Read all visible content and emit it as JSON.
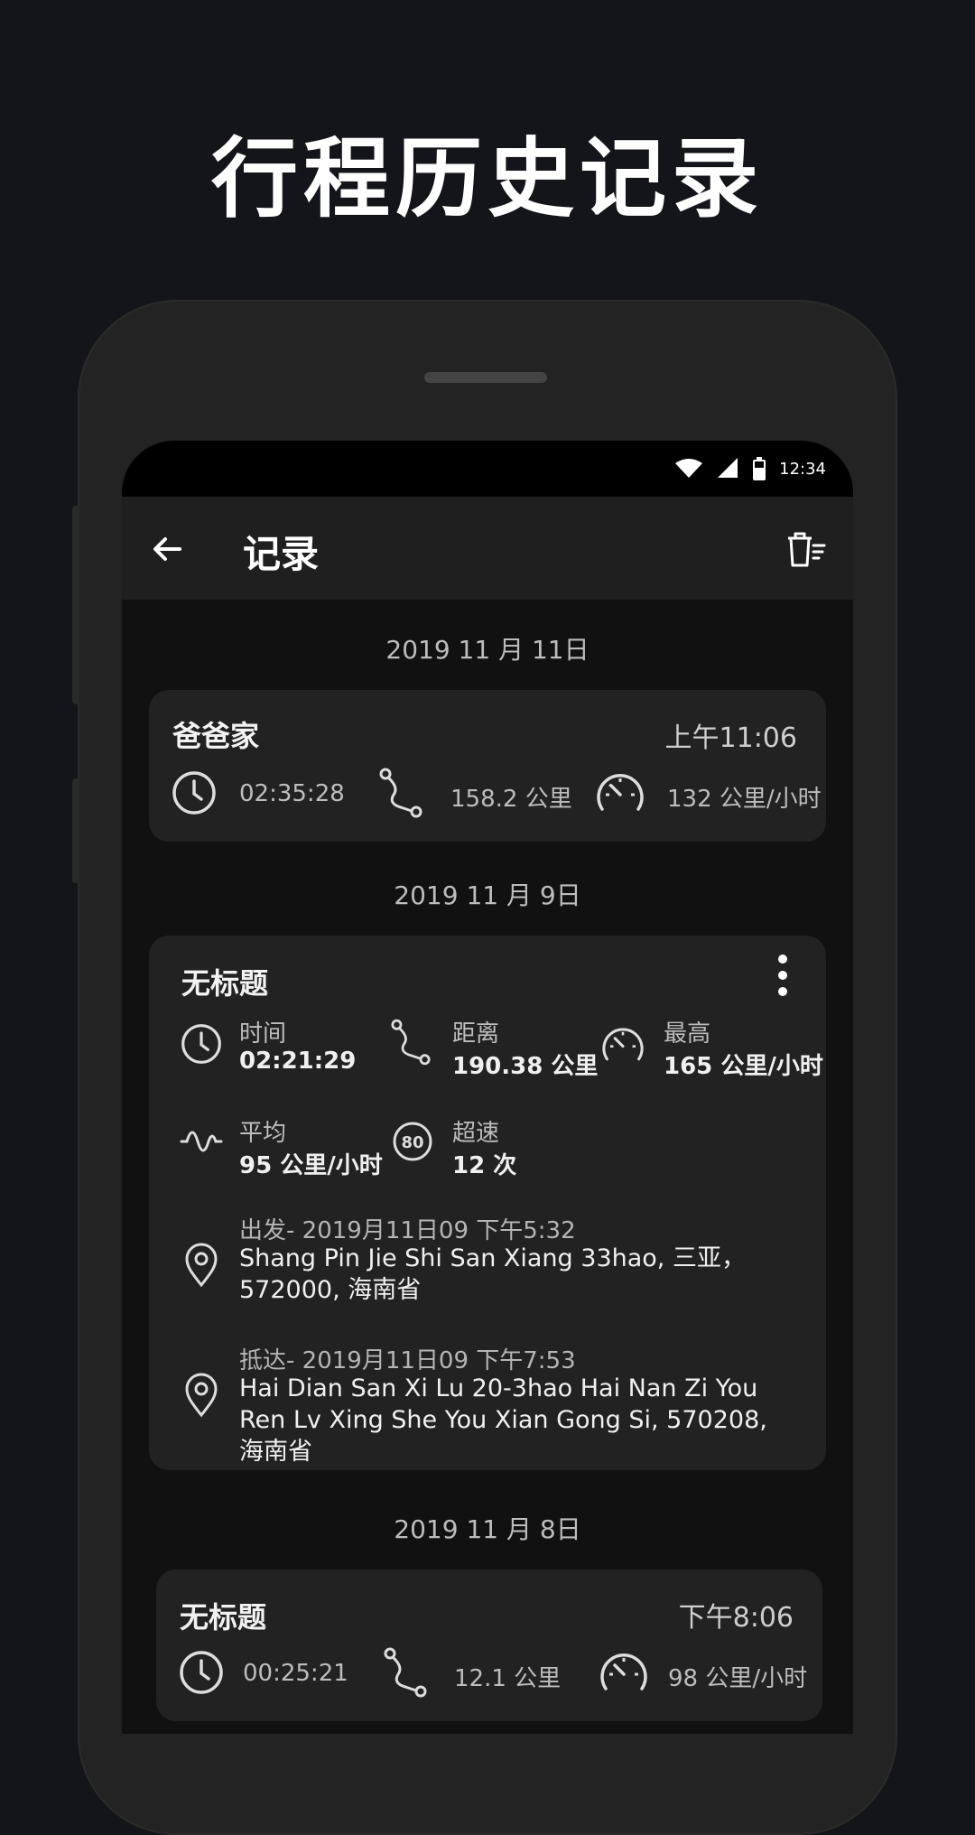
{
  "promo": {
    "title": "行程历史记录"
  },
  "status_bar": {
    "time": "12:34"
  },
  "app_bar": {
    "title": "记录"
  },
  "groups": [
    {
      "date": "2019 11 月 11日",
      "card": {
        "title": "爸爸家",
        "time": "上午11:06",
        "duration": "02:35:28",
        "distance": "158.2 公里",
        "max_speed": "132 公里/小时"
      }
    },
    {
      "date": "2019 11 月 9日",
      "card": {
        "title": "无标题",
        "time_label": "时间",
        "time_value": "02:21:29",
        "distance_label": "距离",
        "distance_value": "190.38 公里",
        "max_label": "最高",
        "max_value": "165 公里/小时",
        "avg_label": "平均",
        "avg_value": "95 公里/小时",
        "overspeed_label": "超速",
        "overspeed_value": "12 次",
        "overspeed_badge": "80",
        "departure_meta": "出发- 2019月11日09 下午5:32",
        "departure_address": "Shang Pin Jie Shi San Xiang 33hao, 三亚， 572000, 海南省",
        "arrival_meta": "抵达- 2019月11日09 下午7:53",
        "arrival_address": "Hai Dian San Xi Lu 20-3hao Hai Nan Zi You Ren Lv Xing She You Xian Gong Si, 570208, 海南省"
      }
    },
    {
      "date": "2019 11 月 8日",
      "card": {
        "title": "无标题",
        "time": "下午8:06",
        "duration": "00:25:21",
        "distance": "12.1 公里",
        "max_speed": "98 公里/小时"
      }
    }
  ],
  "icons": {
    "back": "arrow-left-icon",
    "trash": "trash-icon",
    "clock": "clock-icon",
    "route": "route-icon",
    "speedometer": "speedometer-icon",
    "wave": "wave-icon",
    "overspeed": "overspeed-icon",
    "pin": "location-pin-icon",
    "more": "more-vert-icon"
  },
  "colors": {
    "background": "#14151a",
    "card": "#222222",
    "screen": "#111111"
  }
}
